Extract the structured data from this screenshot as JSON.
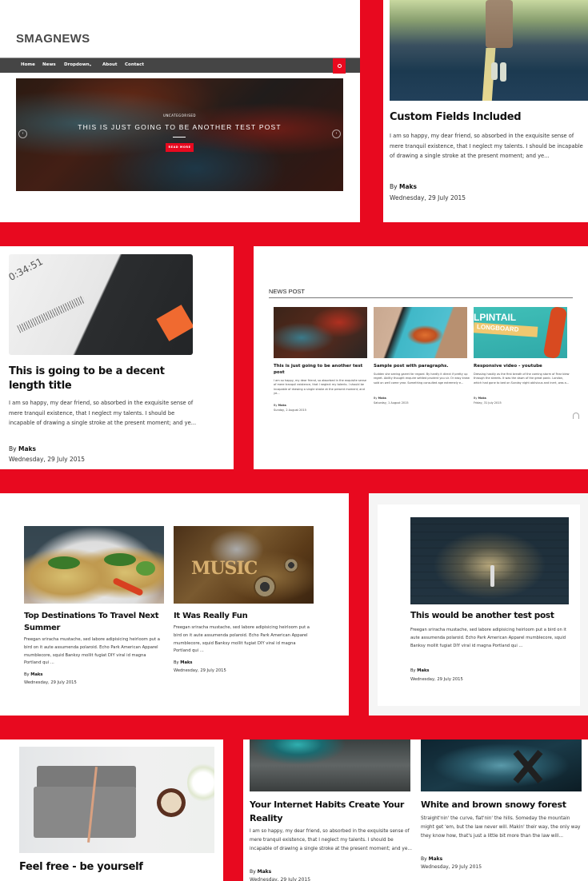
{
  "site": {
    "logo": "SMAGNEWS",
    "nav": [
      "Home",
      "News",
      "Dropdown",
      "About",
      "Contact"
    ],
    "dropdown_caret": "▾",
    "search_icon": "🔍"
  },
  "hero": {
    "category": "UNCATEGORISED",
    "title": "THIS IS JUST GOING TO BE ANOTHER TEST POST",
    "button": "READ MORE",
    "prev_icon": "‹",
    "next_icon": "›"
  },
  "featured_card": {
    "title": "Custom Fields Included",
    "excerpt": "I am so happy, my dear friend, so absorbed in the exquisite sense of mere tranquil existence, that I neglect my talents. I should be incapable of drawing a single stroke at the present moment; and ye...",
    "by": "By",
    "author": "Maks",
    "date": "Wednesday, 29 July 2015"
  },
  "decent_card": {
    "title": "This is going to be a decent length title",
    "excerpt": "I am so happy, my dear friend, so absorbed in the exquisite sense of mere tranquil existence, that I neglect my talents. I should be incapable of drawing a single stroke at the present moment; and ye...",
    "by": "By",
    "author": "Maks",
    "date": "Wednesday, 29 July 2015",
    "image_text": "0:34:51"
  },
  "news_post": {
    "heading": "NEWS POST",
    "items": [
      {
        "title": "This is just going to be another test post",
        "excerpt": "I am so happy, my dear friend, so absorbed in the exquisite sense of mere tranquil existence, that I neglect my talents. I should be incapable of drawing a single stroke at the present moment; and ye...",
        "by": "By",
        "author": "Maks",
        "date": "Sunday, 2 August 2015"
      },
      {
        "title": "Sample post with paragraphs.",
        "excerpt": "Sudden she seeing garret far regard. By hardly it direct if pretty up regret. Ability thought enquire settled prudent you sir. Or easy knew sold on well come year. Something consulted age extremely e...",
        "by": "By",
        "author": "Maks",
        "date": "Saturday, 1 August 2015"
      },
      {
        "title": "Responsive video - youtube",
        "excerpt": "Dressing hastily as the first breath of the coming storm of Fear blew through the streets. It was the dawn of the great panic. London, which had gone to bed on Sunday night oblivious and inert, was a...",
        "by": "By",
        "author": "Maks",
        "date": "Friday, 31 July 2015",
        "image_text_1": "LPINTAIL",
        "image_text_2": "LONGBOARD"
      }
    ]
  },
  "grid_cards": [
    {
      "title": "Top Destinations To Travel Next Summer",
      "excerpt": "Freegan sriracha mustache, sed labore adipisicing heirloom put a bird on it aute assumenda polaroid. Echo Park American Apparel mumblecore, squid Banksy mollit fugiat DIY viral id magna Portland qui ...",
      "by": "By",
      "author": "Maks",
      "date": "Wednesday, 29 July 2015"
    },
    {
      "title": "It Was Really Fun",
      "excerpt": "Freegan sriracha mustache, sed labore adipisicing heirloom put a bird on it aute assumenda polaroid. Echo Park American Apparel mumblecore, squid Banksy mollit fugiat DIY viral id magna Portland qui ...",
      "by": "By",
      "author": "Maks",
      "date": "Wednesday, 29 July 2015",
      "image_text": "MUSIC"
    }
  ],
  "test_card": {
    "title": "This would be another test post",
    "excerpt": "Freegan sriracha mustache, sed labore adipisicing heirloom put a bird on it aute assumenda polaroid. Echo Park American Apparel mumblecore, squid Banksy mollit fugiat DIY viral id magna Portland qui ...",
    "by": "By",
    "author": "Maks",
    "date": "Wednesday, 29 July 2015"
  },
  "feel_free_card": {
    "title": "Feel free - be yourself"
  },
  "bottom_cards": [
    {
      "title": "Your Internet Habits Create Your Reality",
      "excerpt": "I am so happy, my dear friend, so absorbed in the exquisite sense of mere tranquil existence, that I neglect my talents. I should be incapable of drawing a single stroke at the present moment; and ye...",
      "by": "By",
      "author": "Maks",
      "date": "Wednesday, 29 July 2015"
    },
    {
      "title": "White and brown snowy forest",
      "excerpt": "Straight'nin' the curve, flat'nin' the hills. Someday the mountain might get 'em, but the law never will. Makin' their way, the only way they know how, that's just a little bit more than the law will...",
      "by": "By",
      "author": "Maks",
      "date": "Wednesday, 29 July 2015"
    }
  ],
  "colors": {
    "brand_red": "#e8091f",
    "nav_bg": "#454545"
  }
}
